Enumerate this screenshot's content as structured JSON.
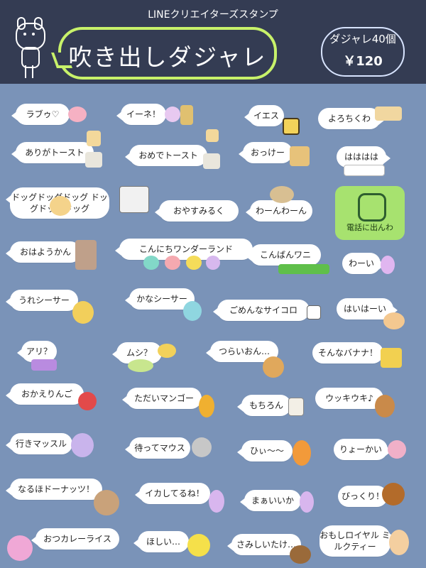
{
  "header": {
    "brand": "LINEクリエイターズスタンプ",
    "title": "吹き出しダジャレ",
    "price_line1": "ダジャレ40個",
    "price_line2": "￥120"
  },
  "stickers": [
    {
      "label": "ラブゥ♡"
    },
    {
      "label": "イーネ！"
    },
    {
      "label": "イエス"
    },
    {
      "label": "よろちくわ"
    },
    {
      "label": "ありがトースト"
    },
    {
      "label": "おめでトースト"
    },
    {
      "label": "おっけー"
    },
    {
      "label": "はははは"
    },
    {
      "label": "ドッグドッグドッグ ドッグドッグドッグ"
    },
    {
      "label": "おやすみるく"
    },
    {
      "label": "わーんわーん"
    },
    {
      "label": "電話に出んわ"
    },
    {
      "label": "おはようかん"
    },
    {
      "label": "こんにちワンダーランド"
    },
    {
      "label": "こんばんワニ"
    },
    {
      "label": "わーい"
    },
    {
      "label": "うれシーサー"
    },
    {
      "label": "かなシーサー"
    },
    {
      "label": "ごめんなサイコロ"
    },
    {
      "label": "はいはーい"
    },
    {
      "label": "アリ？"
    },
    {
      "label": "ムシ？"
    },
    {
      "label": "つらいおん…"
    },
    {
      "label": "そんなバナナ！"
    },
    {
      "label": "おかえりんご"
    },
    {
      "label": "ただいマンゴー"
    },
    {
      "label": "もちろん"
    },
    {
      "label": "ウッキウキ♪"
    },
    {
      "label": "行きマッスル"
    },
    {
      "label": "待ってマウス"
    },
    {
      "label": "ひぃ〜〜"
    },
    {
      "label": "りょーかい"
    },
    {
      "label": "なるほドーナッツ！"
    },
    {
      "label": "イカしてるね！"
    },
    {
      "label": "まぁいいか"
    },
    {
      "label": "びっくり！"
    },
    {
      "label": "おつカレーライス"
    },
    {
      "label": "ほしい…"
    },
    {
      "label": "さみしいたけ…"
    },
    {
      "label": "おもしロイヤル ミルクティー"
    }
  ]
}
